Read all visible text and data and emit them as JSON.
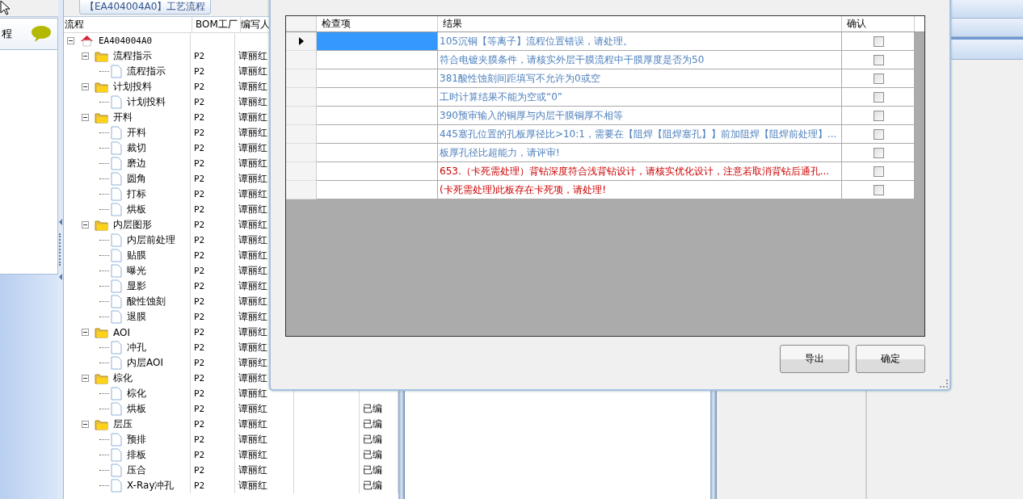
{
  "window": {
    "title": "【EA404004A0】工艺流程"
  },
  "left_panel": {
    "title": "程"
  },
  "tree_grid": {
    "columns": [
      "流程",
      "BOM工厂",
      "编写人"
    ],
    "rows": [
      {
        "label": "EA404004A0",
        "kind": "root",
        "expanded": true,
        "children": [
          {
            "label": "流程指示",
            "kind": "folder",
            "expanded": true,
            "bom": "P2",
            "author": "谭丽红",
            "children": [
              {
                "label": "流程指示",
                "kind": "file",
                "bom": "P2",
                "author": "谭丽红"
              }
            ]
          },
          {
            "label": "计划投料",
            "kind": "folder",
            "expanded": true,
            "bom": "P2",
            "author": "谭丽红",
            "children": [
              {
                "label": "计划投料",
                "kind": "file",
                "bom": "P2",
                "author": "谭丽红"
              }
            ]
          },
          {
            "label": "开料",
            "kind": "folder",
            "expanded": true,
            "bom": "P2",
            "author": "谭丽红",
            "children": [
              {
                "label": "开料",
                "kind": "file",
                "bom": "P2",
                "author": "谭丽红"
              },
              {
                "label": "裁切",
                "kind": "file",
                "bom": "P2",
                "author": "谭丽红"
              },
              {
                "label": "磨边",
                "kind": "file",
                "bom": "P2",
                "author": "谭丽红"
              },
              {
                "label": "圆角",
                "kind": "file",
                "bom": "P2",
                "author": "谭丽红"
              },
              {
                "label": "打标",
                "kind": "file",
                "bom": "P2",
                "author": "谭丽红"
              },
              {
                "label": "烘板",
                "kind": "file",
                "bom": "P2",
                "author": "谭丽红"
              }
            ]
          },
          {
            "label": "内层图形",
            "kind": "folder",
            "expanded": true,
            "bom": "P2",
            "author": "谭丽红",
            "children": [
              {
                "label": "内层前处理",
                "kind": "file",
                "bom": "P2",
                "author": "谭丽红"
              },
              {
                "label": "贴膜",
                "kind": "file",
                "bom": "P2",
                "author": "谭丽红"
              },
              {
                "label": "曝光",
                "kind": "file",
                "bom": "P2",
                "author": "谭丽红"
              },
              {
                "label": "显影",
                "kind": "file",
                "bom": "P2",
                "author": "谭丽红"
              },
              {
                "label": "酸性蚀刻",
                "kind": "file",
                "bom": "P2",
                "author": "谭丽红"
              },
              {
                "label": "退膜",
                "kind": "file",
                "bom": "P2",
                "author": "谭丽红"
              }
            ]
          },
          {
            "label": "AOI",
            "kind": "folder",
            "expanded": true,
            "bom": "P2",
            "author": "谭丽红",
            "children": [
              {
                "label": "冲孔",
                "kind": "file",
                "bom": "P2",
                "author": "谭丽红"
              },
              {
                "label": "内层AOI",
                "kind": "file",
                "bom": "P2",
                "author": "谭丽红"
              }
            ]
          },
          {
            "label": "棕化",
            "kind": "folder",
            "expanded": true,
            "bom": "P2",
            "author": "谭丽红",
            "children": [
              {
                "label": "棕化",
                "kind": "file",
                "bom": "P2",
                "author": "谭丽红"
              },
              {
                "label": "烘板",
                "kind": "file",
                "bom": "P2",
                "author": "谭丽红",
                "status": "已编"
              }
            ]
          },
          {
            "label": "层压",
            "kind": "folder",
            "expanded": true,
            "bom": "P2",
            "author": "谭丽红",
            "status": "已编",
            "children": [
              {
                "label": "预排",
                "kind": "file",
                "bom": "P2",
                "author": "谭丽红",
                "status": "已编"
              },
              {
                "label": "排板",
                "kind": "file",
                "bom": "P2",
                "author": "谭丽红",
                "status": "已编"
              },
              {
                "label": "压合",
                "kind": "file",
                "bom": "P2",
                "author": "谭丽红",
                "status": "已编"
              },
              {
                "label": "X-Ray冲孔",
                "kind": "file",
                "bom": "P2",
                "author": "谭丽红",
                "status": "已编"
              }
            ]
          }
        ]
      }
    ]
  },
  "dialog": {
    "columns": [
      "检查项",
      "结果",
      "确认"
    ],
    "rows": [
      {
        "selected": true,
        "result": "105沉铜【等离子】流程位置错误，请处理。",
        "color": "#4f81bd",
        "checked": false
      },
      {
        "selected": false,
        "result": "符合电镀夹膜条件，请核实外层干膜流程中干膜厚度是否为50",
        "color": "#4f81bd",
        "checked": false
      },
      {
        "selected": false,
        "result": "381酸性蚀刻间距填写不允许为0或空",
        "color": "#4f81bd",
        "checked": false
      },
      {
        "selected": false,
        "result": "工时计算结果不能为空或“0”",
        "color": "#4f81bd",
        "checked": false
      },
      {
        "selected": false,
        "result": "390预审输入的铜厚与内层干膜铜厚不相等",
        "color": "#4f81bd",
        "checked": false
      },
      {
        "selected": false,
        "result": "445塞孔位置的孔板厚径比>10:1，需要在【阻焊【阻焊塞孔】】前加阻焊【阻焊前处理】...",
        "color": "#4f81bd",
        "checked": false
      },
      {
        "selected": false,
        "result": "板厚孔径比超能力，请评审!",
        "color": "#4f81bd",
        "checked": false
      },
      {
        "selected": false,
        "result": "653.（卡死需处理）背钻深度符合浅背钻设计，请核实优化设计，注意若取消背钻后通孔...",
        "color": "#cc0000",
        "checked": false
      },
      {
        "selected": false,
        "result": "(卡死需处理)此板存在卡死项，请处理!",
        "color": "#cc0000",
        "checked": false
      }
    ],
    "buttons": [
      "导出",
      "确定"
    ]
  }
}
